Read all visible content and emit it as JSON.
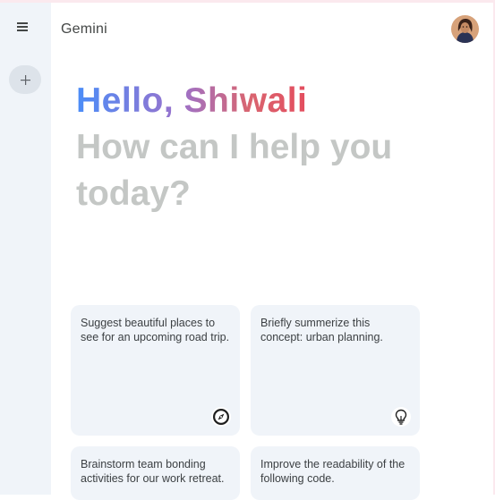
{
  "header": {
    "app_title": "Gemini"
  },
  "greeting": {
    "hello": "Hello, Shiwali",
    "prompt": "How can I help you today?"
  },
  "cards": [
    {
      "text": "Suggest beautiful places to see for an upcoming road trip.",
      "icon": "compass-icon"
    },
    {
      "text": "Briefly summerize this concept: urban planning.",
      "icon": "lightbulb-icon"
    },
    {
      "text": "Brainstorm team bonding activities for our work retreat.",
      "icon": ""
    },
    {
      "text": "Improve the readability of the following code.",
      "icon": ""
    }
  ],
  "colors": {
    "sidebar_bg": "#f0f4f9",
    "card_bg": "#f0f4f9",
    "gradient_start": "#4b8df8",
    "gradient_end": "#e44d5e",
    "subtitle": "#c4c7c5"
  }
}
